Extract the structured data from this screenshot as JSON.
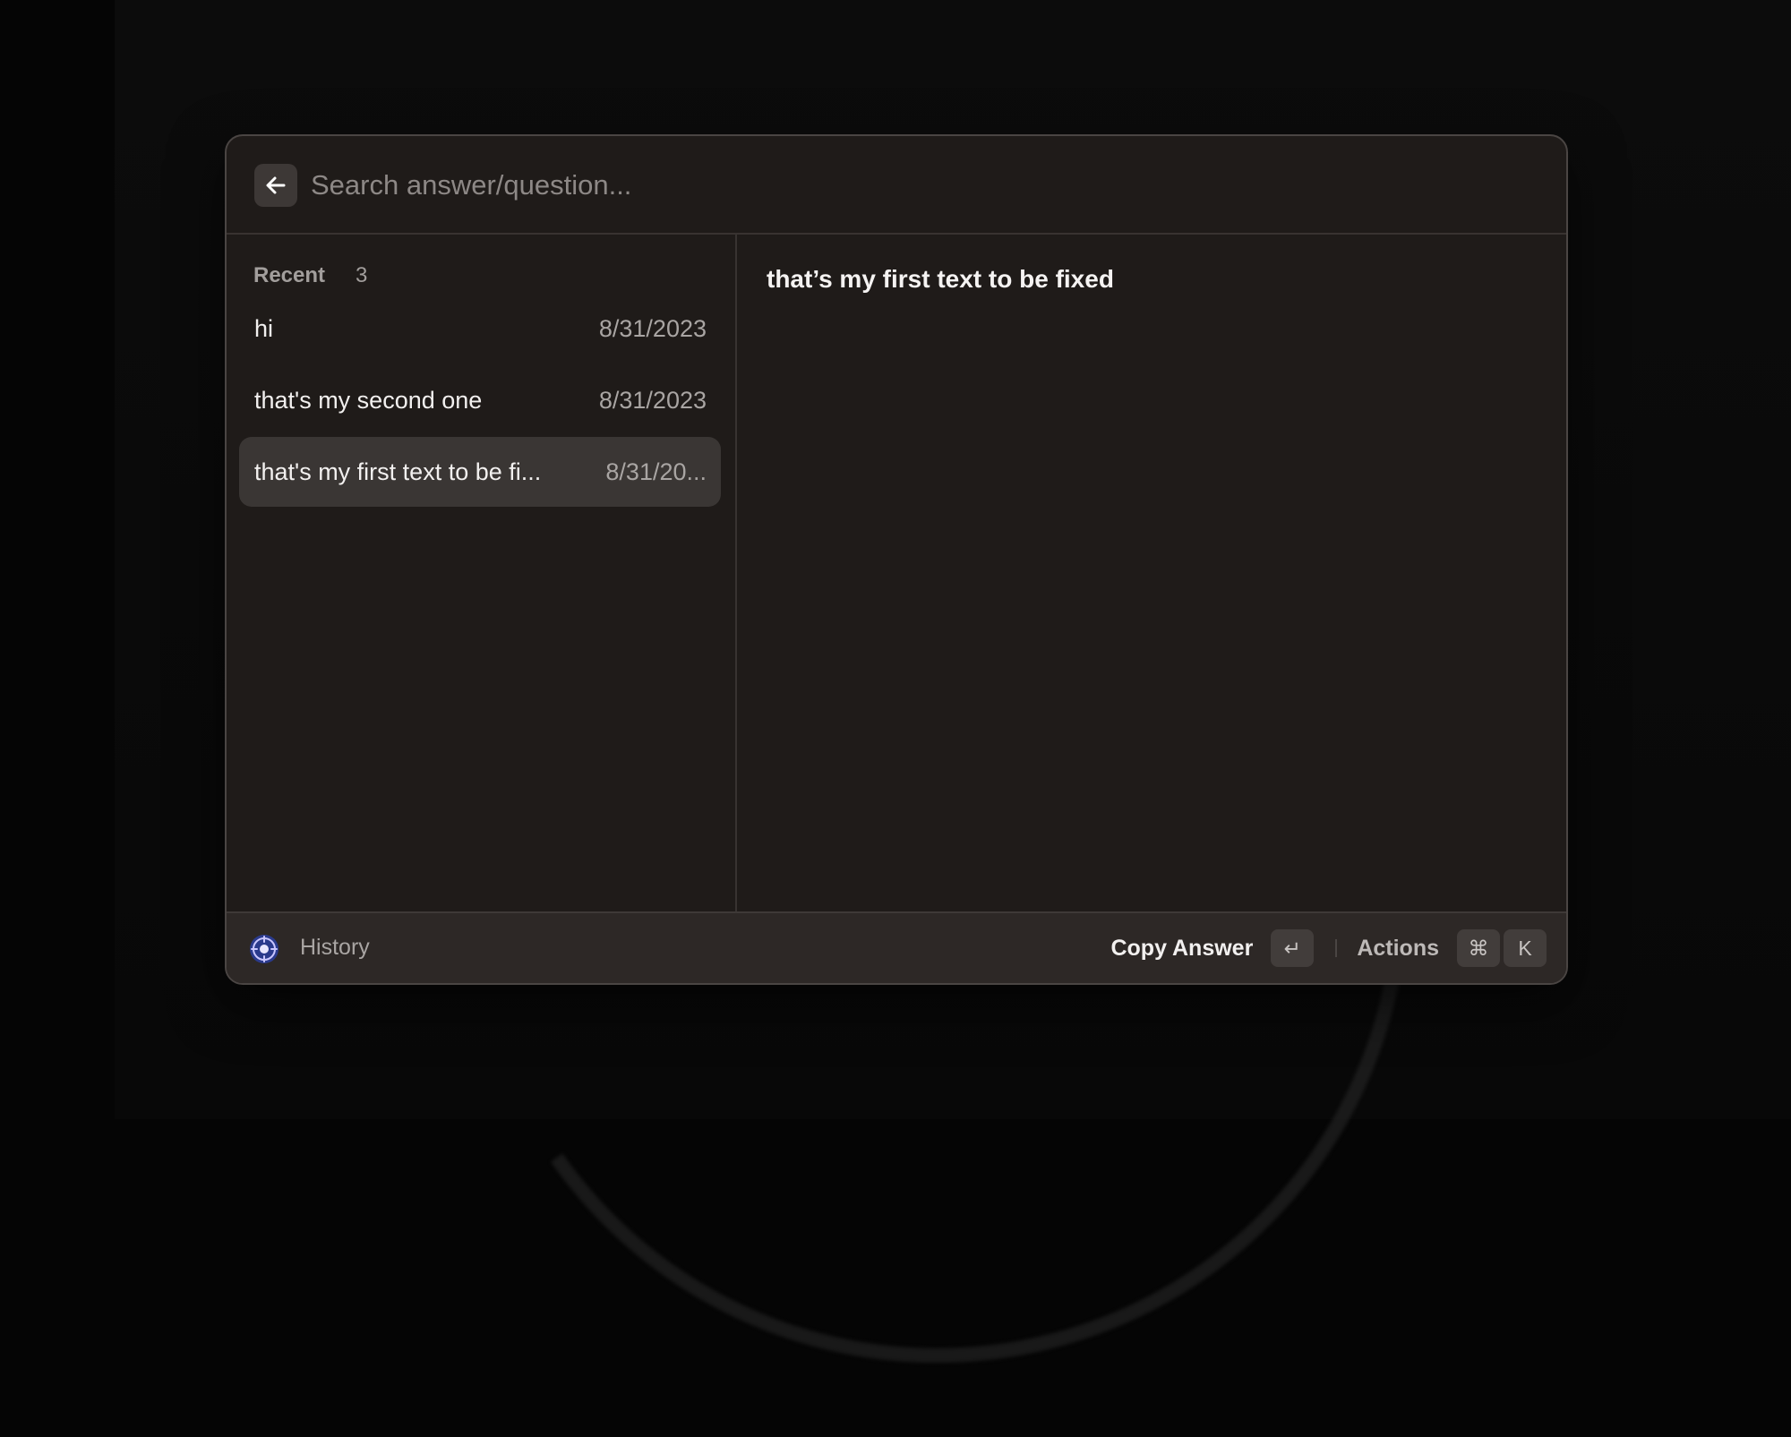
{
  "search": {
    "placeholder": "Search answer/question...",
    "value": ""
  },
  "sidebar": {
    "section_title": "Recent",
    "count": "3",
    "items": [
      {
        "title": "hi",
        "date": "8/31/2023"
      },
      {
        "title": "that's my second one",
        "date": "8/31/2023"
      },
      {
        "title": "that's my first text to be fi...",
        "date": "8/31/20..."
      }
    ]
  },
  "detail": {
    "answer": "that’s my first text to be fixed"
  },
  "footer": {
    "title": "History",
    "primary_action": "Copy Answer",
    "primary_key": "↵",
    "secondary_action": "Actions",
    "secondary_keys": [
      "⌘",
      "K"
    ]
  },
  "icons": {
    "back": "arrow-left-icon",
    "logo": "app-logo-icon"
  },
  "colors": {
    "window_bg": "#1f1b19",
    "selected_row": "#3a3634",
    "footer_bg": "#2d2826"
  }
}
